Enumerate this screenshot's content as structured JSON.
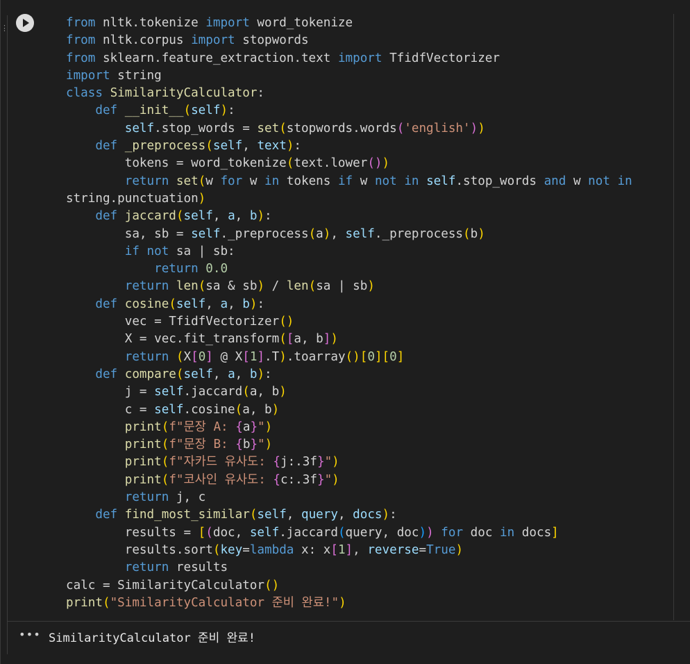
{
  "cell": {
    "run_icon": "play-icon",
    "gutter_mark": "⋮",
    "code_lines": [
      [
        [
          "kw",
          "from"
        ],
        [
          "t",
          " nltk.tokenize "
        ],
        [
          "kw",
          "import"
        ],
        [
          "t",
          " word_tokenize"
        ]
      ],
      [
        [
          "kw",
          "from"
        ],
        [
          "t",
          " nltk.corpus "
        ],
        [
          "kw",
          "import"
        ],
        [
          "t",
          " stopwords"
        ]
      ],
      [
        [
          "kw",
          "from"
        ],
        [
          "t",
          " sklearn.feature_extraction.text "
        ],
        [
          "kw",
          "import"
        ],
        [
          "t",
          " TfidfVectorizer"
        ]
      ],
      [
        [
          "kw",
          "import"
        ],
        [
          "t",
          " string"
        ]
      ],
      [
        [
          "kw",
          "class"
        ],
        [
          "t",
          " "
        ],
        [
          "cls",
          "SimilarityCalculator"
        ],
        [
          "t",
          ":"
        ]
      ],
      [
        [
          "t",
          "    "
        ],
        [
          "kw",
          "def"
        ],
        [
          "t",
          " "
        ],
        [
          "fn",
          "__init__"
        ],
        [
          "p1",
          "("
        ],
        [
          "selfc",
          "self"
        ],
        [
          "p1",
          ")"
        ],
        [
          "t",
          ":"
        ]
      ],
      [
        [
          "t",
          "        "
        ],
        [
          "selfc",
          "self"
        ],
        [
          "t",
          ".stop_words = "
        ],
        [
          "bi",
          "set"
        ],
        [
          "p1",
          "("
        ],
        [
          "t",
          "stopwords.words"
        ],
        [
          "p2",
          "("
        ],
        [
          "str",
          "'english'"
        ],
        [
          "p2",
          ")"
        ],
        [
          "p1",
          ")"
        ]
      ],
      [
        [
          "t",
          "    "
        ],
        [
          "kw",
          "def"
        ],
        [
          "t",
          " "
        ],
        [
          "fn",
          "_preprocess"
        ],
        [
          "p1",
          "("
        ],
        [
          "selfc",
          "self"
        ],
        [
          "t",
          ", "
        ],
        [
          "param",
          "text"
        ],
        [
          "p1",
          ")"
        ],
        [
          "t",
          ":"
        ]
      ],
      [
        [
          "t",
          "        tokens = word_tokenize"
        ],
        [
          "p1",
          "("
        ],
        [
          "t",
          "text.lower"
        ],
        [
          "p2",
          "()"
        ],
        [
          "p1",
          ")"
        ]
      ],
      [
        [
          "t",
          "        "
        ],
        [
          "kw",
          "return"
        ],
        [
          "t",
          " "
        ],
        [
          "bi",
          "set"
        ],
        [
          "p1",
          "("
        ],
        [
          "t",
          "w "
        ],
        [
          "kw",
          "for"
        ],
        [
          "t",
          " w "
        ],
        [
          "kw",
          "in"
        ],
        [
          "t",
          " tokens "
        ],
        [
          "kw",
          "if"
        ],
        [
          "t",
          " w "
        ],
        [
          "kw",
          "not"
        ],
        [
          "t",
          " "
        ],
        [
          "kw",
          "in"
        ],
        [
          "t",
          " "
        ],
        [
          "selfc",
          "self"
        ],
        [
          "t",
          ".stop_words "
        ],
        [
          "kw",
          "and"
        ],
        [
          "t",
          " w "
        ],
        [
          "kw",
          "not"
        ],
        [
          "t",
          " "
        ],
        [
          "kw",
          "in"
        ]
      ],
      [
        [
          "t",
          "string.punctuation"
        ],
        [
          "p1",
          ")"
        ]
      ],
      [
        [
          "t",
          "    "
        ],
        [
          "kw",
          "def"
        ],
        [
          "t",
          " "
        ],
        [
          "fn",
          "jaccard"
        ],
        [
          "p1",
          "("
        ],
        [
          "selfc",
          "self"
        ],
        [
          "t",
          ", "
        ],
        [
          "param",
          "a"
        ],
        [
          "t",
          ", "
        ],
        [
          "param",
          "b"
        ],
        [
          "p1",
          ")"
        ],
        [
          "t",
          ":"
        ]
      ],
      [
        [
          "t",
          "        sa, sb = "
        ],
        [
          "selfc",
          "self"
        ],
        [
          "t",
          "._preprocess"
        ],
        [
          "p1",
          "("
        ],
        [
          "t",
          "a"
        ],
        [
          "p1",
          ")"
        ],
        [
          "t",
          ", "
        ],
        [
          "selfc",
          "self"
        ],
        [
          "t",
          "._preprocess"
        ],
        [
          "p1",
          "("
        ],
        [
          "t",
          "b"
        ],
        [
          "p1",
          ")"
        ]
      ],
      [
        [
          "t",
          "        "
        ],
        [
          "kw",
          "if"
        ],
        [
          "t",
          " "
        ],
        [
          "kw",
          "not"
        ],
        [
          "t",
          " sa | sb:"
        ]
      ],
      [
        [
          "t",
          "            "
        ],
        [
          "kw",
          "return"
        ],
        [
          "t",
          " "
        ],
        [
          "num",
          "0.0"
        ]
      ],
      [
        [
          "t",
          "        "
        ],
        [
          "kw",
          "return"
        ],
        [
          "t",
          " "
        ],
        [
          "bi",
          "len"
        ],
        [
          "p1",
          "("
        ],
        [
          "t",
          "sa & sb"
        ],
        [
          "p1",
          ")"
        ],
        [
          "t",
          " / "
        ],
        [
          "bi",
          "len"
        ],
        [
          "p1",
          "("
        ],
        [
          "t",
          "sa | sb"
        ],
        [
          "p1",
          ")"
        ]
      ],
      [
        [
          "t",
          "    "
        ],
        [
          "kw",
          "def"
        ],
        [
          "t",
          " "
        ],
        [
          "fn",
          "cosine"
        ],
        [
          "p1",
          "("
        ],
        [
          "selfc",
          "self"
        ],
        [
          "t",
          ", "
        ],
        [
          "param",
          "a"
        ],
        [
          "t",
          ", "
        ],
        [
          "param",
          "b"
        ],
        [
          "p1",
          ")"
        ],
        [
          "t",
          ":"
        ]
      ],
      [
        [
          "t",
          "        vec = TfidfVectorizer"
        ],
        [
          "p1",
          "()"
        ]
      ],
      [
        [
          "t",
          "        X = vec.fit_transform"
        ],
        [
          "p1",
          "("
        ],
        [
          "p2",
          "["
        ],
        [
          "t",
          "a, b"
        ],
        [
          "p2",
          "]"
        ],
        [
          "p1",
          ")"
        ]
      ],
      [
        [
          "t",
          "        "
        ],
        [
          "kw",
          "return"
        ],
        [
          "t",
          " "
        ],
        [
          "p1",
          "("
        ],
        [
          "t",
          "X"
        ],
        [
          "p2",
          "["
        ],
        [
          "num",
          "0"
        ],
        [
          "p2",
          "]"
        ],
        [
          "t",
          " @ X"
        ],
        [
          "p2",
          "["
        ],
        [
          "num",
          "1"
        ],
        [
          "p2",
          "]"
        ],
        [
          "t",
          ".T"
        ],
        [
          "p1",
          ")"
        ],
        [
          "t",
          ".toarray"
        ],
        [
          "p1",
          "()"
        ],
        [
          "p1",
          "["
        ],
        [
          "num",
          "0"
        ],
        [
          "p1",
          "]"
        ],
        [
          "p1",
          "["
        ],
        [
          "num",
          "0"
        ],
        [
          "p1",
          "]"
        ]
      ],
      [
        [
          "t",
          "    "
        ],
        [
          "kw",
          "def"
        ],
        [
          "t",
          " "
        ],
        [
          "fn",
          "compare"
        ],
        [
          "p1",
          "("
        ],
        [
          "selfc",
          "self"
        ],
        [
          "t",
          ", "
        ],
        [
          "param",
          "a"
        ],
        [
          "t",
          ", "
        ],
        [
          "param",
          "b"
        ],
        [
          "p1",
          ")"
        ],
        [
          "t",
          ":"
        ]
      ],
      [
        [
          "t",
          "        j = "
        ],
        [
          "selfc",
          "self"
        ],
        [
          "t",
          ".jaccard"
        ],
        [
          "p1",
          "("
        ],
        [
          "t",
          "a, b"
        ],
        [
          "p1",
          ")"
        ]
      ],
      [
        [
          "t",
          "        c = "
        ],
        [
          "selfc",
          "self"
        ],
        [
          "t",
          ".cosine"
        ],
        [
          "p1",
          "("
        ],
        [
          "t",
          "a, b"
        ],
        [
          "p1",
          ")"
        ]
      ],
      [
        [
          "t",
          "        "
        ],
        [
          "bi",
          "print"
        ],
        [
          "p1",
          "("
        ],
        [
          "str",
          "f\"문장 A: "
        ],
        [
          "p2",
          "{"
        ],
        [
          "t",
          "a"
        ],
        [
          "p2",
          "}"
        ],
        [
          "str",
          "\""
        ],
        [
          "p1",
          ")"
        ]
      ],
      [
        [
          "t",
          "        "
        ],
        [
          "bi",
          "print"
        ],
        [
          "p1",
          "("
        ],
        [
          "str",
          "f\"문장 B: "
        ],
        [
          "p2",
          "{"
        ],
        [
          "t",
          "b"
        ],
        [
          "p2",
          "}"
        ],
        [
          "str",
          "\""
        ],
        [
          "p1",
          ")"
        ]
      ],
      [
        [
          "t",
          "        "
        ],
        [
          "bi",
          "print"
        ],
        [
          "p1",
          "("
        ],
        [
          "str",
          "f\"자카드 유사도: "
        ],
        [
          "p2",
          "{"
        ],
        [
          "t",
          "j:.3f"
        ],
        [
          "p2",
          "}"
        ],
        [
          "str",
          "\""
        ],
        [
          "p1",
          ")"
        ]
      ],
      [
        [
          "t",
          "        "
        ],
        [
          "bi",
          "print"
        ],
        [
          "p1",
          "("
        ],
        [
          "str",
          "f\"코사인 유사도: "
        ],
        [
          "p2",
          "{"
        ],
        [
          "t",
          "c:.3f"
        ],
        [
          "p2",
          "}"
        ],
        [
          "str",
          "\""
        ],
        [
          "p1",
          ")"
        ]
      ],
      [
        [
          "t",
          "        "
        ],
        [
          "kw",
          "return"
        ],
        [
          "t",
          " j, c"
        ]
      ],
      [
        [
          "t",
          "    "
        ],
        [
          "kw",
          "def"
        ],
        [
          "t",
          " "
        ],
        [
          "fn",
          "find_most_similar"
        ],
        [
          "p1",
          "("
        ],
        [
          "selfc",
          "self"
        ],
        [
          "t",
          ", "
        ],
        [
          "param",
          "query"
        ],
        [
          "t",
          ", "
        ],
        [
          "param",
          "docs"
        ],
        [
          "p1",
          ")"
        ],
        [
          "t",
          ":"
        ]
      ],
      [
        [
          "t",
          "        results = "
        ],
        [
          "p1",
          "["
        ],
        [
          "p2",
          "("
        ],
        [
          "t",
          "doc, "
        ],
        [
          "selfc",
          "self"
        ],
        [
          "t",
          ".jaccard"
        ],
        [
          "p3",
          "("
        ],
        [
          "t",
          "query, doc"
        ],
        [
          "p3",
          ")"
        ],
        [
          "p2",
          ")"
        ],
        [
          "t",
          " "
        ],
        [
          "kw",
          "for"
        ],
        [
          "t",
          " doc "
        ],
        [
          "kw",
          "in"
        ],
        [
          "t",
          " docs"
        ],
        [
          "p1",
          "]"
        ]
      ],
      [
        [
          "t",
          "        results.sort"
        ],
        [
          "p1",
          "("
        ],
        [
          "param",
          "key"
        ],
        [
          "t",
          "="
        ],
        [
          "kw",
          "lambda"
        ],
        [
          "t",
          " x: x"
        ],
        [
          "p2",
          "["
        ],
        [
          "num",
          "1"
        ],
        [
          "p2",
          "]"
        ],
        [
          "t",
          ", "
        ],
        [
          "param",
          "reverse"
        ],
        [
          "t",
          "="
        ],
        [
          "kw",
          "True"
        ],
        [
          "p1",
          ")"
        ]
      ],
      [
        [
          "t",
          "        "
        ],
        [
          "kw",
          "return"
        ],
        [
          "t",
          " results"
        ]
      ],
      [
        [
          "t",
          "calc = SimilarityCalculator"
        ],
        [
          "p1",
          "()"
        ]
      ],
      [
        [
          "bi",
          "print"
        ],
        [
          "p1",
          "("
        ],
        [
          "str",
          "\"SimilarityCalculator 준비 완료!\""
        ],
        [
          "p1",
          ")"
        ]
      ]
    ]
  },
  "output": {
    "menu_label": "•••",
    "text": "SimilarityCalculator 준비 완료!"
  }
}
